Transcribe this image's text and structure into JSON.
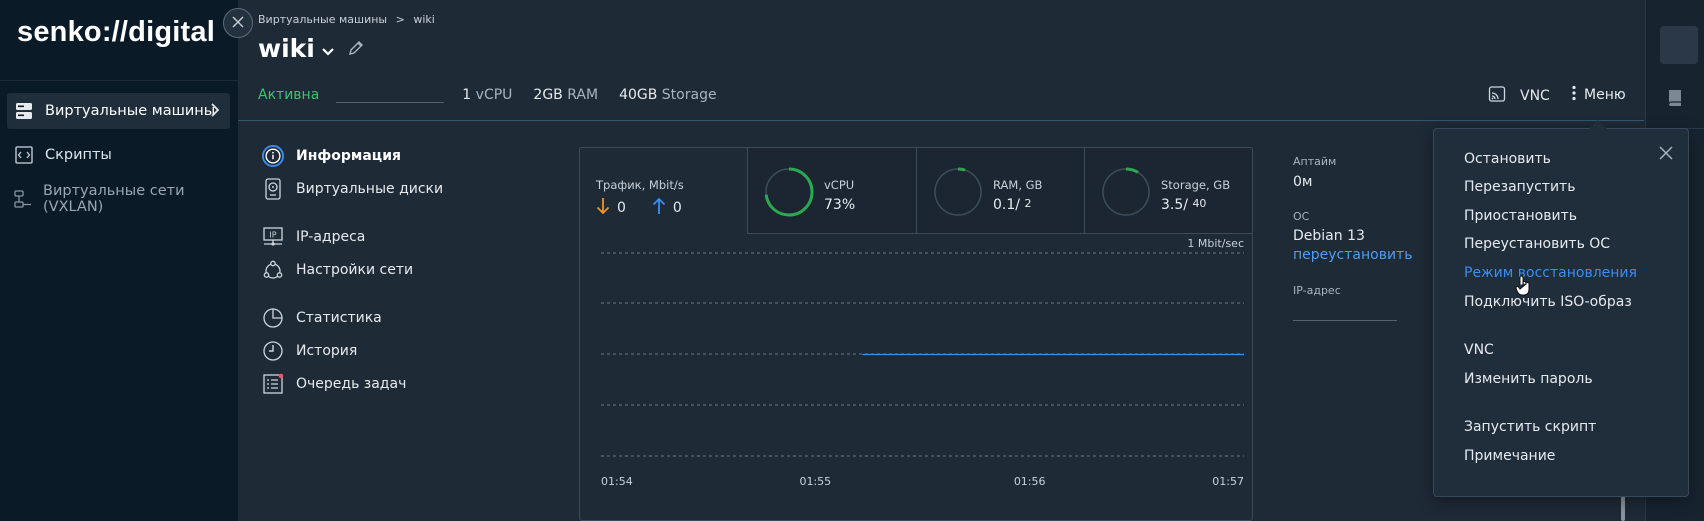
{
  "sidebar": {
    "logo": "senko://digital",
    "items": [
      {
        "label": "Виртуальные машины",
        "icon": "server-icon",
        "active": true
      },
      {
        "label": "Скрипты",
        "icon": "script-icon"
      },
      {
        "label": "Виртуальные сети (VXLAN)",
        "icon": "network-icon",
        "muted": true
      }
    ]
  },
  "header": {
    "breadcrumb": {
      "parent": "Виртуальные машины",
      "separator": ">",
      "current": "wiki"
    },
    "title": "wiki",
    "status": "Активна",
    "specs": {
      "cpu_value": "1",
      "cpu_unit": "vCPU",
      "ram_value": "2GB",
      "ram_unit": "RAM",
      "storage_value": "40GB",
      "storage_unit": "Storage"
    },
    "vnc_label": "VNC",
    "menu_label": "Меню"
  },
  "info_menu": [
    {
      "label": "Информация",
      "icon": "info-icon",
      "active": true
    },
    {
      "label": "Виртуальные диски",
      "icon": "disk-icon"
    },
    {
      "label": "IP-адреса",
      "icon": "ip-icon"
    },
    {
      "label": "Настройки сети",
      "icon": "network-settings-icon"
    },
    {
      "label": "Статистика",
      "icon": "pie-chart-icon"
    },
    {
      "label": "История",
      "icon": "clock-icon"
    },
    {
      "label": "Очередь задач",
      "icon": "task-queue-icon"
    }
  ],
  "stats_tabs": {
    "traffic": {
      "label": "Трафик, Mbit/s",
      "down": "0",
      "up": "0"
    },
    "cpu": {
      "label": "vCPU",
      "value": "73%",
      "fraction": 0.73
    },
    "ram": {
      "label": "RAM, GB",
      "used": "0.1",
      "total": "2",
      "fraction": 0.05
    },
    "storage": {
      "label": "Storage, GB",
      "used": "3.5",
      "total": "40",
      "fraction": 0.0875
    }
  },
  "colors": {
    "accent": "#3a8ff0",
    "success": "#3ec46d",
    "down_arrow": "#f0932b",
    "up_arrow": "#3a8ff0",
    "gauge": "#2ea84f"
  },
  "chart_data": {
    "type": "line",
    "title": "",
    "scale_label": "1 Mbit/sec",
    "x": [
      "01:54",
      "01:55",
      "01:56",
      "01:57"
    ],
    "series": [
      {
        "points": [
          [
            1.22,
            0
          ],
          [
            3.0,
            0
          ]
        ]
      }
    ],
    "ylim": [
      -1,
      1
    ],
    "grid": true
  },
  "right_info": {
    "uptime_label": "Аптайм",
    "uptime_value": "0м",
    "os_label": "ОС",
    "os_value": "Debian 13",
    "os_link": "переустановить",
    "ip_label": "IP-адрес"
  },
  "dropdown": {
    "groups": [
      [
        "Остановить",
        "Перезапустить",
        "Приостановить",
        "Переустановить ОС",
        "Режим восстановления",
        "Подключить ISO-образ"
      ],
      [
        "VNC",
        "Изменить пароль"
      ],
      [
        "Запустить скрипт",
        "Примечание"
      ]
    ],
    "highlighted": "Режим восстановления"
  }
}
